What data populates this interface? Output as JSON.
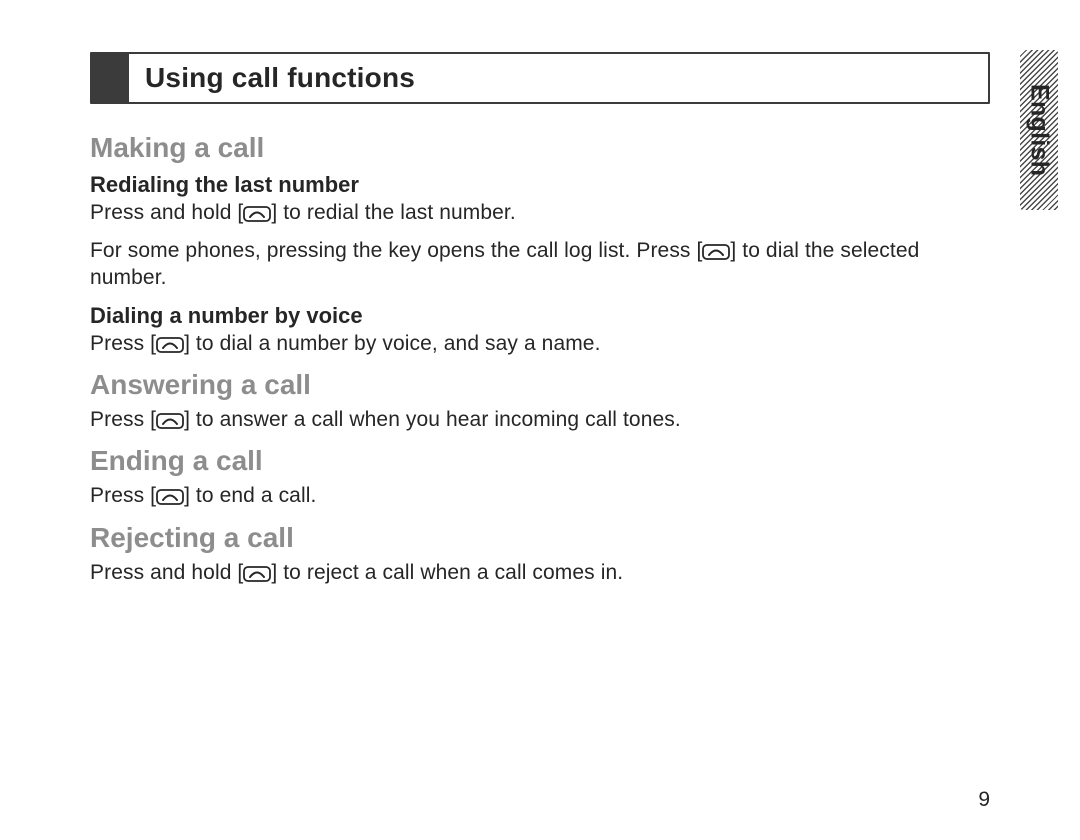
{
  "header": {
    "chapter_title": "Using call functions"
  },
  "tab": {
    "language": "English"
  },
  "body": {
    "making": {
      "heading": "Making a call",
      "redial": {
        "heading": "Redialing the last number",
        "p1a": "Press and hold [",
        "p1b": "] to redial the last number.",
        "p2a": "For some phones, pressing the key opens the call log list. Press [",
        "p2b": "] to dial the selected number."
      },
      "voice": {
        "heading": "Dialing a number by voice",
        "p1a": "Press [",
        "p1b": "] to dial a number by voice, and say a name."
      }
    },
    "answering": {
      "heading": "Answering a call",
      "p1a": "Press [",
      "p1b": "] to answer a call when you hear incoming call tones."
    },
    "ending": {
      "heading": "Ending a call",
      "p1a": "Press [",
      "p1b": "] to end a call."
    },
    "rejecting": {
      "heading": "Rejecting a call",
      "p1a": "Press and hold [",
      "p1b": "] to reject a call when a call comes in."
    }
  },
  "page_number": "9",
  "icons": {
    "call_key": "call-key-icon"
  }
}
